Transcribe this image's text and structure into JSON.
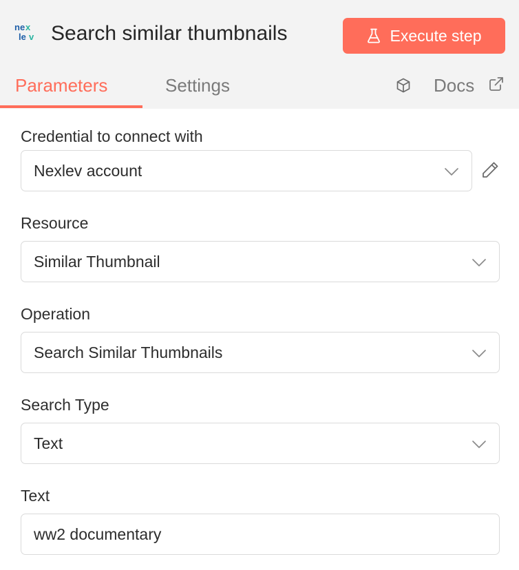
{
  "header": {
    "title": "Search similar thumbnails",
    "execute_label": "Execute step",
    "accent_color": "#ff6d5a"
  },
  "tabs": [
    {
      "label": "Parameters",
      "active": true
    },
    {
      "label": "Settings",
      "active": false
    }
  ],
  "docs_label": "Docs",
  "form": {
    "credential": {
      "label": "Credential to connect with",
      "value": "Nexlev account"
    },
    "resource": {
      "label": "Resource",
      "value": "Similar Thumbnail"
    },
    "operation": {
      "label": "Operation",
      "value": "Search Similar Thumbnails"
    },
    "search_type": {
      "label": "Search Type",
      "value": "Text"
    },
    "text": {
      "label": "Text",
      "value": "ww2 documentary"
    }
  },
  "icons": {
    "logo": "nexlev-logo-icon",
    "execute": "flask-icon",
    "node_info": "cube-icon",
    "docs_external": "external-link-icon",
    "edit_credential": "pencil-icon",
    "dropdown": "chevron-down-icon"
  }
}
